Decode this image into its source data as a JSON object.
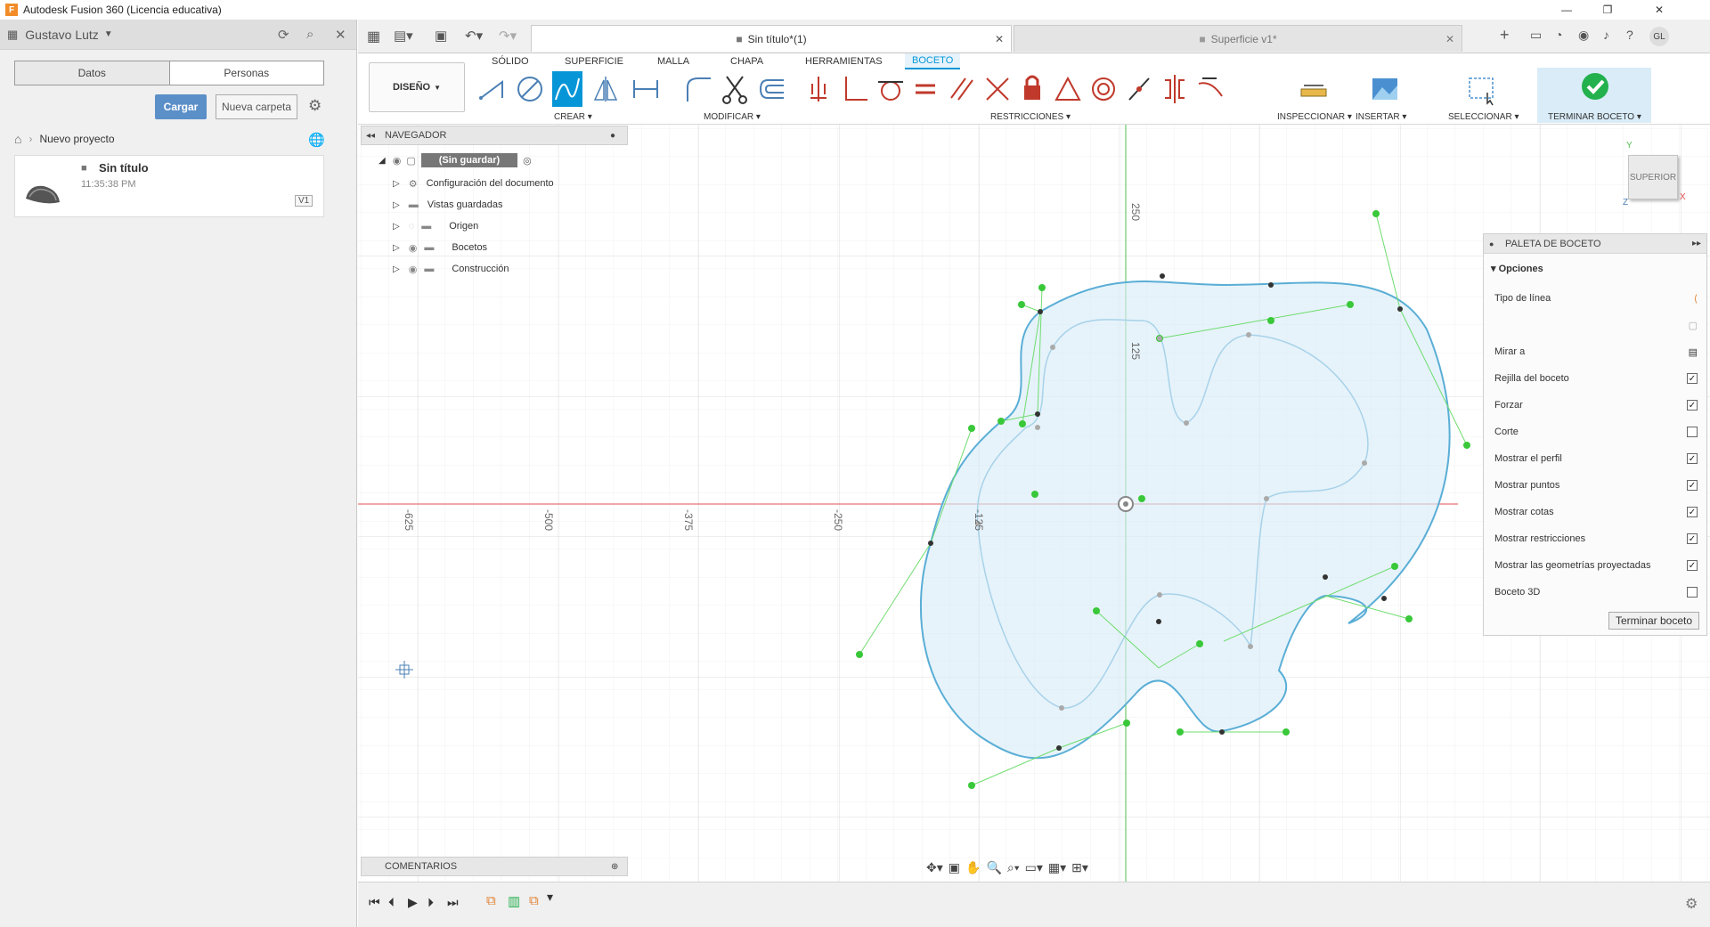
{
  "window": {
    "title": "Autodesk Fusion 360 (Licencia educativa)"
  },
  "datapanel": {
    "user": "Gustavo Lutz",
    "tabs": [
      "Datos",
      "Personas"
    ],
    "upload_label": "Cargar",
    "new_folder_label": "Nueva carpeta",
    "breadcrumb": "Nuevo proyecto",
    "file": {
      "name": "Sin título",
      "time": "11:35:38 PM",
      "version": "V1"
    }
  },
  "doctabs": [
    {
      "label": "Sin título*(1)",
      "active": true
    },
    {
      "label": "Superficie v1*",
      "active": false
    }
  ],
  "user_initials": "GL",
  "ribbon": {
    "tabs": [
      "SÓLIDO",
      "SUPERFICIE",
      "MALLA",
      "CHAPA",
      "HERRAMIENTAS",
      "BOCETO"
    ],
    "active_tab": "BOCETO",
    "design": "DISEÑO",
    "groups": [
      "CREAR",
      "MODIFICAR",
      "RESTRICCIONES",
      "INSPECCIONAR",
      "INSERTAR",
      "SELECCIONAR",
      "TERMINAR BOCETO"
    ]
  },
  "browser": {
    "title": "NAVEGADOR",
    "root": "(Sin guardar)",
    "items": [
      "Configuración del documento",
      "Vistas guardadas",
      "Origen",
      "Bocetos",
      "Construcción"
    ]
  },
  "comments": "COMENTARIOS",
  "axis_labels": {
    "x": [
      "-625",
      "-500",
      "-375",
      "-250",
      "-125"
    ],
    "y": [
      "250",
      "125"
    ]
  },
  "viewcube": "SUPERIOR",
  "palette": {
    "title": "PALETA DE BOCETO",
    "section": "Opciones",
    "rows": [
      {
        "label": "Tipo de línea",
        "type": "icon"
      },
      {
        "label": "",
        "type": "icon2"
      },
      {
        "label": "Mirar a",
        "type": "icon3"
      },
      {
        "label": "Rejilla del boceto",
        "checked": true
      },
      {
        "label": "Forzar",
        "checked": true
      },
      {
        "label": "Corte",
        "checked": false
      },
      {
        "label": "Mostrar el perfil",
        "checked": true
      },
      {
        "label": "Mostrar puntos",
        "checked": true
      },
      {
        "label": "Mostrar cotas",
        "checked": true
      },
      {
        "label": "Mostrar restricciones",
        "checked": true
      },
      {
        "label": "Mostrar las geometrías proyectadas",
        "checked": true
      },
      {
        "label": "Boceto 3D",
        "checked": false
      }
    ],
    "finish_label": "Terminar boceto"
  },
  "colors": {
    "accent": "#0696d7",
    "curve": "#5aaed6",
    "fill": "#d9ecf8",
    "handle": "#39c839",
    "xaxis": "#e05050",
    "yaxis": "#4fc04f",
    "finish": "#23b14d"
  }
}
